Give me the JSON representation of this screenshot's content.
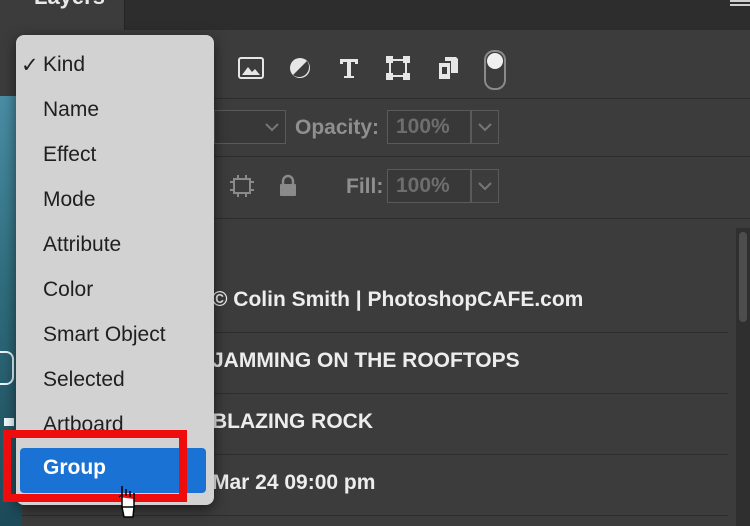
{
  "panel": {
    "tab_title": "Layers",
    "opacity_label": "Opacity:",
    "opacity_value": "100%",
    "fill_label": "Fill:",
    "fill_value": "100%"
  },
  "filter_icons": [
    "image-filter-icon",
    "adjustment-filter-icon",
    "type-filter-icon",
    "shape-filter-icon",
    "smart-object-filter-icon"
  ],
  "layers": [
    {
      "name": "© Colin Smith | PhotoshopCAFE.com"
    },
    {
      "name": "JAMMING ON THE ROOFTOPS"
    },
    {
      "name": "BLAZING ROCK"
    },
    {
      "name": "Mar 24 09:00 pm"
    }
  ],
  "dropdown": {
    "checkmark": "✓",
    "items": [
      {
        "label": "Kind"
      },
      {
        "label": "Name"
      },
      {
        "label": "Effect"
      },
      {
        "label": "Mode"
      },
      {
        "label": "Attribute"
      },
      {
        "label": "Color"
      },
      {
        "label": "Smart Object"
      },
      {
        "label": "Selected"
      },
      {
        "label": "Artboard"
      },
      {
        "label": "Group"
      }
    ],
    "selected_index": 9,
    "checked_index": 0
  },
  "colors": {
    "highlight": "#ee0c0c",
    "selection": "#1a73d4",
    "panel": "#3c3c3c"
  }
}
